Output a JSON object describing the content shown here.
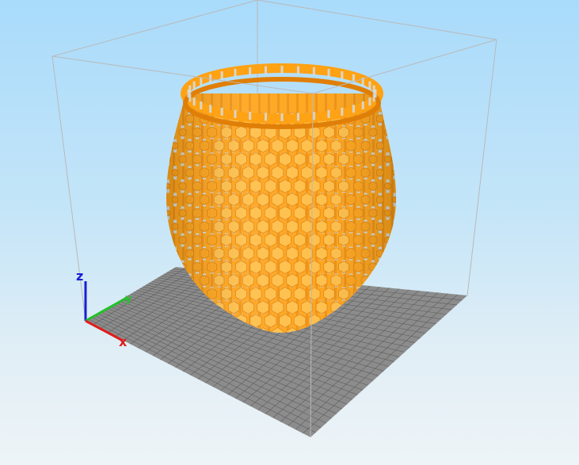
{
  "app": {
    "view": "3d-preview",
    "background_colors": [
      "#a9dbfb",
      "#eef4f7"
    ]
  },
  "scene": {
    "build_plate": {
      "color": "#8c8c8c",
      "grid_color": "#5e5e5e"
    },
    "build_volume": {
      "edge_color": "#b9b9b9"
    },
    "model": {
      "shape": "lattice-vase-with-hexagon-pattern",
      "color": "#ffa214",
      "shade_color": "#e07f07",
      "highlight_color": "#ffbd43"
    },
    "axes": {
      "x": {
        "label": "x",
        "color": "#e21b1b"
      },
      "y": {
        "label": "y",
        "color": "#23c12a"
      },
      "z": {
        "label": "z",
        "color": "#1a1fd6"
      }
    }
  }
}
